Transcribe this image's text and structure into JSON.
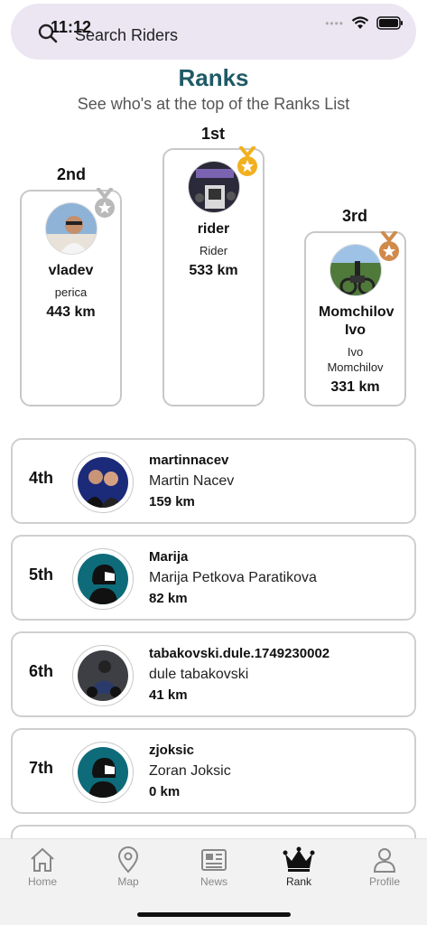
{
  "status": {
    "time": "11:12"
  },
  "search": {
    "placeholder": "Search Riders"
  },
  "header": {
    "title": "Ranks",
    "subtitle": "See who's at the top of the Ranks List"
  },
  "podium": {
    "first": {
      "place": "1st",
      "username": "rider",
      "full_name": "Rider",
      "distance": "533 km",
      "medal_color": "#f2b01e"
    },
    "second": {
      "place": "2nd",
      "username": "vladev",
      "full_name": "perica",
      "distance": "443 km",
      "medal_color": "#b9b9b9"
    },
    "third": {
      "place": "3rd",
      "username": "Momchilov Ivo",
      "full_name": "Ivo Momchilov",
      "distance": "331 km",
      "medal_color": "#d08a4a"
    }
  },
  "ranks": [
    {
      "place": "4th",
      "username": "martinnacev",
      "full_name": "Martin Nacev",
      "distance": "159 km"
    },
    {
      "place": "5th",
      "username": "Marija",
      "full_name": "Marija Petkova Paratikova",
      "distance": "82 km"
    },
    {
      "place": "6th",
      "username": "tabakovski.dule.1749230002",
      "full_name": "dule tabakovski",
      "distance": "41 km"
    },
    {
      "place": "7th",
      "username": "zjoksic",
      "full_name": "Zoran Joksic",
      "distance": "0 km"
    }
  ],
  "tabs": [
    {
      "label": "Home",
      "icon": "home-icon"
    },
    {
      "label": "Map",
      "icon": "map-pin-icon"
    },
    {
      "label": "News",
      "icon": "newspaper-icon"
    },
    {
      "label": "Rank",
      "icon": "crown-icon",
      "active": true
    },
    {
      "label": "Profile",
      "icon": "person-icon"
    }
  ],
  "colors": {
    "accent": "#1f5a66",
    "search_bg": "#ebe6f2",
    "card_border": "#c8c8c8"
  }
}
